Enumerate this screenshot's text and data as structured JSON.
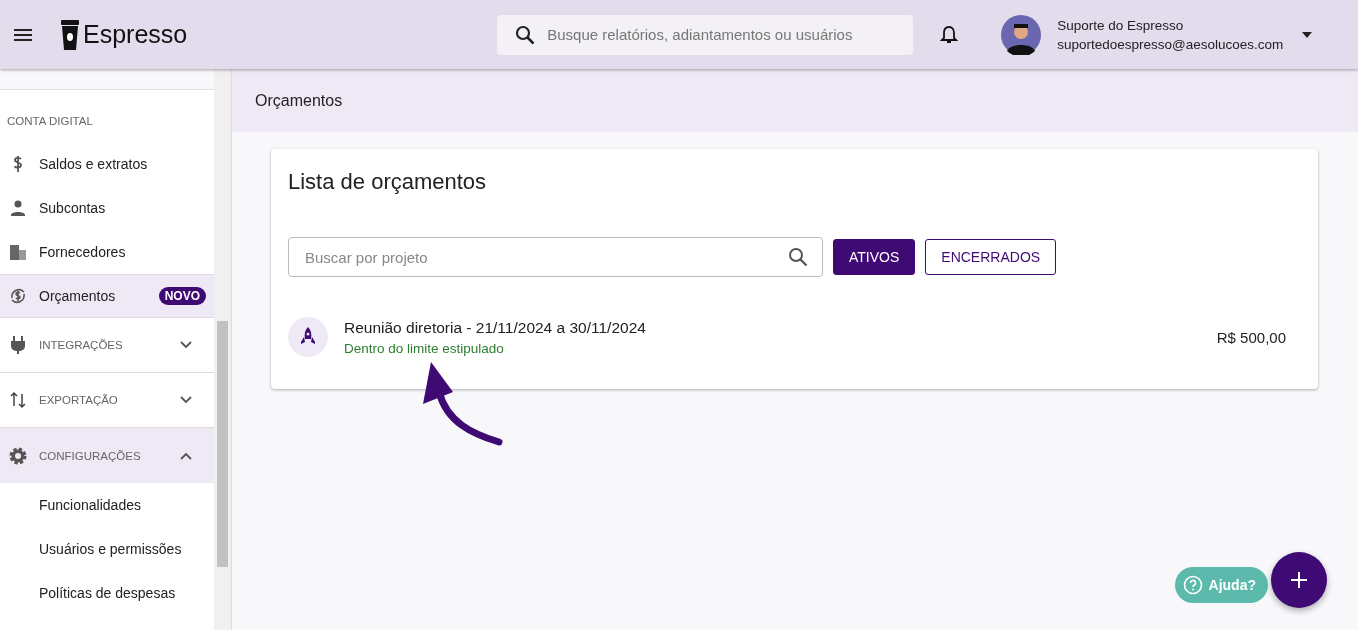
{
  "header": {
    "brand": "Espresso",
    "search": {
      "placeholder": "Busque relatórios, adiantamentos ou usuários"
    },
    "user": {
      "name": "Suporte do Espresso",
      "email": "suportedoespresso@aesolucoes.com"
    }
  },
  "sidebar": {
    "items": [
      {
        "kind": "section",
        "label": "CONTA DIGITAL"
      },
      {
        "kind": "item",
        "label": "Saldos e extratos",
        "selected": false
      },
      {
        "kind": "item",
        "label": "Subcontas",
        "selected": false
      },
      {
        "kind": "item",
        "label": "Fornecedores",
        "selected": false
      },
      {
        "kind": "item",
        "label": "Orçamentos",
        "selected": true,
        "badge": "NOVO"
      },
      {
        "kind": "group",
        "label": "INTEGRAÇÕES",
        "expanded": false
      },
      {
        "kind": "group",
        "label": "EXPORTAÇÃO",
        "expanded": false
      },
      {
        "kind": "group",
        "label": "CONFIGURAÇÕES",
        "expanded": true,
        "children": [
          {
            "label": "Funcionalidades"
          },
          {
            "label": "Usuários e permissões"
          },
          {
            "label": "Políticas de despesas"
          }
        ]
      }
    ]
  },
  "page": {
    "title": "Orçamentos"
  },
  "card": {
    "title": "Lista de orçamentos",
    "search": {
      "placeholder": "Buscar por projeto"
    },
    "filters": [
      {
        "label": "ATIVOS",
        "selected": true
      },
      {
        "label": "ENCERRADOS",
        "selected": false
      }
    ],
    "budgets": [
      {
        "title": "Reunião diretoria - 21/11/2024 a 30/11/2024",
        "status": "Dentro do limite estipulado",
        "color": "#2e7d32",
        "amount": "R$ 500,00"
      }
    ]
  },
  "help": {
    "label": "Ajuda?"
  }
}
